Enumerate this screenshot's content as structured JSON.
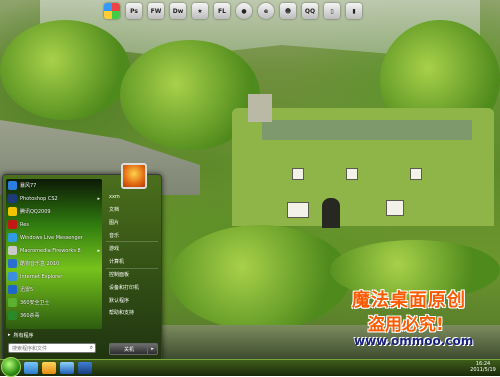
{
  "top_dock": {
    "icons": [
      {
        "name": "windows-logo-icon",
        "label": ""
      },
      {
        "name": "photoshop-icon",
        "label": "Ps"
      },
      {
        "name": "fireworks-icon",
        "label": "FW"
      },
      {
        "name": "dreamweaver-icon",
        "label": "Dw"
      },
      {
        "name": "favorites-star-icon",
        "label": "★"
      },
      {
        "name": "flash-icon",
        "label": "FL"
      },
      {
        "name": "chat-bubble-icon",
        "label": "●"
      },
      {
        "name": "ie-browser-icon",
        "label": "e"
      },
      {
        "name": "messenger-icon",
        "label": "☻"
      },
      {
        "name": "qq-penguin-icon",
        "label": "QQ"
      },
      {
        "name": "document-icon",
        "label": "▯"
      },
      {
        "name": "recycle-bin-icon",
        "label": "▮"
      }
    ]
  },
  "start_menu": {
    "programs": [
      {
        "label": "暴风77",
        "color": "#2a7de1",
        "arrow": ""
      },
      {
        "label": "Photoshop CS2",
        "color": "#1d3b7a",
        "arrow": "▸"
      },
      {
        "label": "腾讯QQ2009",
        "color": "#f0c400",
        "arrow": ""
      },
      {
        "label": "Res",
        "color": "#c21818",
        "arrow": ""
      },
      {
        "label": "Windows Live Messenger",
        "color": "#2f9be0",
        "arrow": ""
      },
      {
        "label": "Macromedia Fireworks 8",
        "color": "#c9c9c9",
        "arrow": "▸"
      },
      {
        "label": "酷狗音乐盒 2010",
        "color": "#2a6fd0",
        "arrow": ""
      },
      {
        "label": "Internet Explorer",
        "color": "#3c8fe0",
        "arrow": ""
      },
      {
        "label": "迅雷5",
        "color": "#1e67c9",
        "arrow": ""
      },
      {
        "label": "360安全卫士",
        "color": "#5bb030",
        "arrow": ""
      },
      {
        "label": "360杀毒",
        "color": "#2a8a2a",
        "arrow": ""
      }
    ],
    "all_programs": "所有程序",
    "search_placeholder": "搜索程序和文件",
    "right_items": [
      {
        "label": "xxm",
        "sep": false
      },
      {
        "label": "文档",
        "sep": false
      },
      {
        "label": "图片",
        "sep": false
      },
      {
        "label": "音乐",
        "sep": true
      },
      {
        "label": "游戏",
        "sep": false
      },
      {
        "label": "计算机",
        "sep": true
      },
      {
        "label": "控制面板",
        "sep": false
      },
      {
        "label": "设备和打印机",
        "sep": false
      },
      {
        "label": "默认程序",
        "sep": false
      },
      {
        "label": "帮助和支持",
        "sep": false
      }
    ],
    "shutdown_label": "关机",
    "shutdown_arrow": "▸"
  },
  "watermark": {
    "line1": "魔法桌面原创",
    "line2": "盗用必究!",
    "line3": "www.ommoo.com"
  },
  "taskbar": {
    "clock_time": "16:24",
    "clock_date": "2011/5/19"
  }
}
